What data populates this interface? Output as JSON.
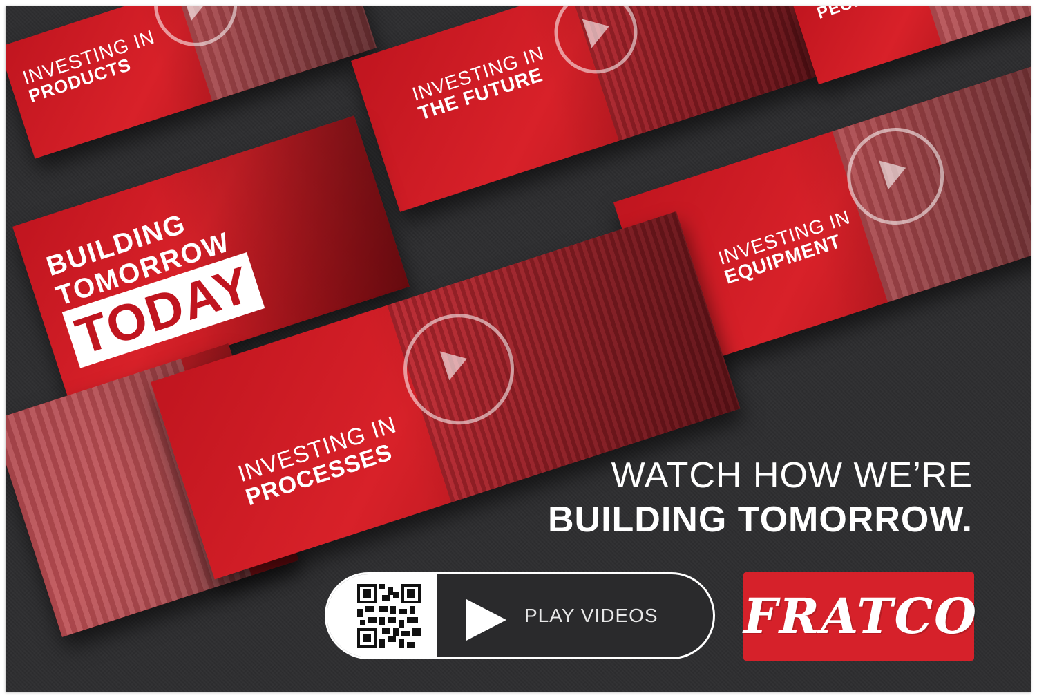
{
  "tiles": {
    "products": {
      "small": "Investing in",
      "big": "Products"
    },
    "future": {
      "small": "Investing in",
      "big": "The Future"
    },
    "people": {
      "big": "People"
    },
    "today": {
      "line1": "Building",
      "line2": "Tomorrow",
      "line3": "Today"
    },
    "equipment": {
      "small": "Investing in",
      "big": "Equipment"
    },
    "processes": {
      "small": "Investing in",
      "big": "Processes"
    }
  },
  "headline": {
    "line1": "WATCH HOW WE’RE",
    "line2": "BUILDING TOMORROW."
  },
  "cta": {
    "label": "PLAY VIDEOS",
    "qr_icon": "qr-code-icon",
    "play_icon": "play-icon"
  },
  "brand": {
    "name": "FRATCO",
    "color": "#d6212a"
  },
  "colors": {
    "background": "#2e2e30",
    "tile_red": "#d82129",
    "text": "#ffffff"
  }
}
